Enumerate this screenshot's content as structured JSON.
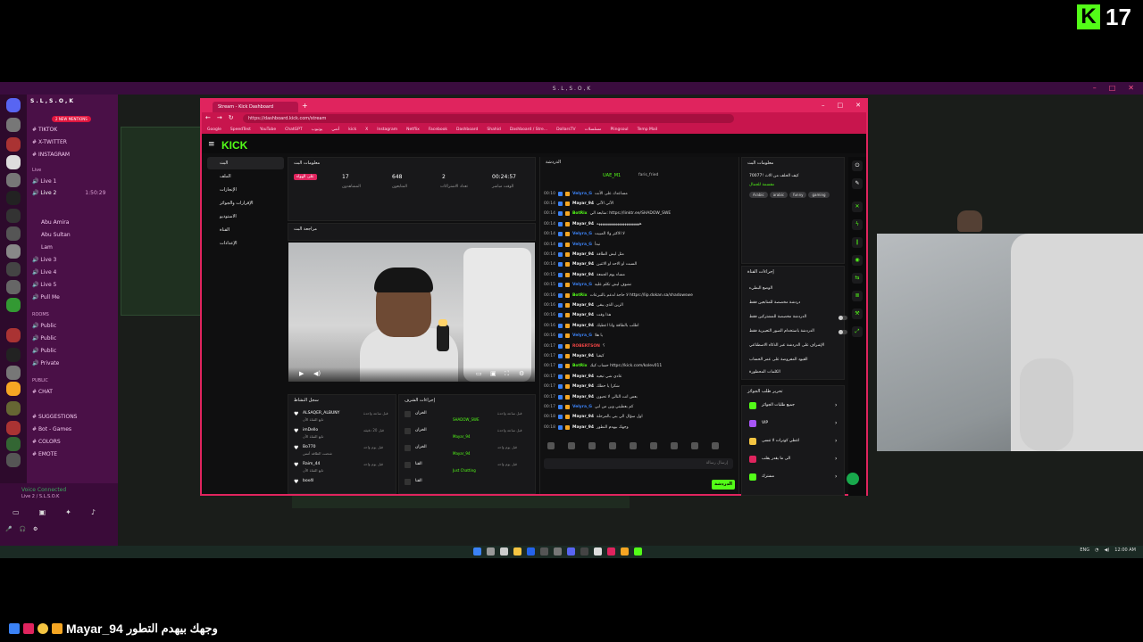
{
  "overlay": {
    "kick_badge_letter": "K",
    "kick_badge_count": "17",
    "ticker_user": "Mayar_94",
    "ticker_message": "وجهك بيهدم التطور"
  },
  "desktop": {
    "window_title": "S . L , S . O , K"
  },
  "discord": {
    "server_name": "S . L , S . O , K",
    "mentions_pill": "2 NEW MENTIONS",
    "channels_top": [
      "TIKTOK",
      "X-TWITTER",
      "INSTAGRAM"
    ],
    "live_category": "Live",
    "live_channels": [
      "Live 1",
      "Live 2"
    ],
    "live2_duration": "1:50:29",
    "live_users": [
      "Abu Amira",
      "Abu Sultan",
      "Lam"
    ],
    "more_live": [
      "Live 3",
      "Live 4",
      "Live 5",
      "Pull Me"
    ],
    "rooms_category": "ROOMS",
    "rooms": [
      "Public",
      "Public",
      "Public",
      "Private"
    ],
    "public_category": "PUBLIC",
    "public_channels": [
      "CHAT",
      "SUGGESTIONS",
      "Bot - Games",
      "COLORS",
      "EMOTE"
    ],
    "voice_status": "Voice Connected",
    "voice_channel": "Live 2 / S.L.S.O.K"
  },
  "browser": {
    "tab_title": "Stream - Kick Dashboard",
    "url": "https://dashboard.kick.com/stream",
    "bookmarks": [
      "Google",
      "SpeedTest",
      "YouTube",
      "ChatGPT",
      "يوتيوب",
      "أنمي",
      "kick",
      "X",
      "Instagram",
      "Netflix",
      "Facebook",
      "Dashboard",
      "Shahid",
      "Dashboard / Stre...",
      "DollarsTV",
      "مسلسلات",
      "Plingsoul",
      "Temp Mail"
    ]
  },
  "kick": {
    "logo": "KICK",
    "nav": [
      "البث",
      "الملف",
      "الإنجازات",
      "الإقرارات والجوائز",
      "الاستوديو",
      "القناة",
      "الإعدادات"
    ],
    "stream_info_title": "معلومات البث",
    "stats": {
      "live_badge": "على الهواء",
      "viewers": "17",
      "followers": "648",
      "subs": "2",
      "duration": "00:24:57",
      "viewers_label": "المشاهدون",
      "followers_label": "المتابعون",
      "subs_label": "تعداد الاشتراكات",
      "duration_label": "الوقت مباشر"
    },
    "preview_title": "مراجعة البث",
    "activity_title": "سجل النشاط",
    "actions_title": "إجراءات الشرف",
    "activity_items": [
      {
        "name": "ALSAQER_ALBUNY",
        "sub": "تابع القناة الآن",
        "time": "قبل ساعة واحدة"
      },
      {
        "name": "imDello",
        "sub": "تابع القناة الآن",
        "time": "قبل 20 دقيقة"
      },
      {
        "name": "Bo770",
        "sub": "شحنت الطاقة أمس",
        "time": "قبل يوم واحد"
      },
      {
        "name": "Raim_44",
        "sub": "تابع القناة الآن",
        "time": "قبل يوم واحد"
      },
      {
        "name": "box4l",
        "sub": "",
        "time": ""
      }
    ],
    "action_items": [
      {
        "title": "الخزان",
        "sub": "SHADOW_SWE",
        "time": "قبل ساعة واحدة"
      },
      {
        "title": "الخزان",
        "sub": "Mayar_94",
        "time": "قبل ساعة واحدة"
      },
      {
        "title": "الخزان",
        "sub": "Mayar_94",
        "time": "قبل يوم واحد"
      },
      {
        "title": "القنا",
        "sub": "Just Chatting",
        "time": "قبل يوم واحد"
      },
      {
        "title": "القنا",
        "sub": "",
        "time": ""
      }
    ],
    "chat_title": "الدردشة",
    "pinned_user": "UAE_M1",
    "pinned_sub": "faris_fried",
    "chat_messages": [
      {
        "ts": "00:10",
        "user": "Velyra_G",
        "color": "#3b82f6",
        "text": "مساعدك على الأنت"
      },
      {
        "ts": "00:14",
        "user": "Mayar_94",
        "color": "#eeeeee",
        "text": "الآتي الآتي"
      },
      {
        "ts": "00:14",
        "user": "BotRix",
        "color": "#53fc18",
        "text": "متابعة الي: https://linktr.ee/SHADOW_SWE"
      },
      {
        "ts": "00:14",
        "user": "Mayar_94",
        "color": "#eeeeee",
        "text": "هههههههههههههههههههههههه"
      },
      {
        "ts": "00:14",
        "user": "Velyra_G",
        "color": "#3b82f6",
        "text": "لا الاكثر ولا المبيت"
      },
      {
        "ts": "00:14",
        "user": "Velyra_G",
        "color": "#3b82f6",
        "text": "نبدأ"
      },
      {
        "ts": "00:14",
        "user": "Mayar_94",
        "color": "#eeeeee",
        "text": "مثل ليش الطاقة"
      },
      {
        "ts": "00:14",
        "user": "Mayar_94",
        "color": "#eeeeee",
        "text": "السبت او الاحد او الاثنين"
      },
      {
        "ts": "00:15",
        "user": "Mayar_94",
        "color": "#eeeeee",
        "text": "مساء يوم الجمعة"
      },
      {
        "ts": "00:15",
        "user": "Velyra_G",
        "color": "#3b82f6",
        "text": "نشوف ليش تكلم عليه"
      },
      {
        "ts": "00:16",
        "user": "BotRix",
        "color": "#53fc18",
        "text": "لا حاجة لدعم بالتبرعات https://lip.dokan.sa/shadowswe"
      },
      {
        "ts": "00:16",
        "user": "Mayar_94",
        "color": "#eeeeee",
        "text": "الزين الذي يبقى"
      },
      {
        "ts": "00:16",
        "user": "Mayar_94",
        "color": "#eeeeee",
        "text": "هذا وقت"
      },
      {
        "ts": "00:16",
        "user": "Mayar_94",
        "color": "#eeeeee",
        "text": "اطلب بالطاقة وانا اعطيك"
      },
      {
        "ts": "00:16",
        "user": "Velyra_G",
        "color": "#3b82f6",
        "text": "يا هلا"
      },
      {
        "ts": "00:17",
        "user": "ROBERTSON",
        "color": "#ef4444",
        "text": "؟"
      },
      {
        "ts": "00:17",
        "user": "Mayar_94",
        "color": "#eeeeee",
        "text": "كيفيا"
      },
      {
        "ts": "00:17",
        "user": "BotRix",
        "color": "#53fc18",
        "text": "حساب كيك https://kick.com/kolev011"
      },
      {
        "ts": "00:17",
        "user": "Mayar_94",
        "color": "#eeeeee",
        "text": "عادي شي تبغيه"
      },
      {
        "ts": "00:17",
        "user": "Mayar_94",
        "color": "#eeeeee",
        "text": "شكرا يا حظك"
      },
      {
        "ts": "00:17",
        "user": "Mayar_94",
        "color": "#eeeeee",
        "text": "بعض انت التالي لا تحبون"
      },
      {
        "ts": "00:17",
        "user": "Velyra_G",
        "color": "#3b82f6",
        "text": "كم بعطيني وين من ابي"
      },
      {
        "ts": "00:18",
        "user": "Mayar_94",
        "color": "#eeeeee",
        "text": "اول سؤال الي بني بالمرحلة"
      },
      {
        "ts": "00:18",
        "user": "Mayar_94",
        "color": "#eeeeee",
        "text": "وجهك بيهدم التطور"
      }
    ],
    "chat_placeholder": "إرسال رسالة",
    "chat_send": "الدردشة",
    "channel_info_title": "معلومات البث",
    "channel_stream_title": "كيف الحلف من الاث !70077",
    "channel_category": "مقسمة للجمال",
    "channel_tags": [
      "Arabic",
      "arabic",
      "funny",
      "gaming"
    ],
    "channel_actions_title": "إجراءات القناة",
    "channel_actions": [
      "الوضع البطيء",
      "دردشة مخصصة للمتابعين فقط",
      "الدردشة مخصصة للمشتركين فقط",
      "الدردشة باستخدام الصور التعبيرية فقط",
      "الإشراف على الدردشة عبر الذكاء الاصطناعي",
      "القيود المفروضة على عمر الحساب",
      "الكلمات المحظورة"
    ],
    "rewards_title": "تحرير طلب الجوائز",
    "rewards": [
      {
        "name": "جميع طلبات الجوائز",
        "color": "#53fc18"
      },
      {
        "name": "VIP",
        "color": "#a855f7"
      },
      {
        "name": "اعطي كونرات لا تنسى",
        "color": "#f5c542"
      },
      {
        "name": "الى ما يقدر يقلب",
        "color": "#e0245e"
      },
      {
        "name": "مشترك",
        "color": "#53fc18"
      }
    ]
  },
  "taskbar": {
    "lang": "ENG",
    "time": "12:00 AM"
  }
}
